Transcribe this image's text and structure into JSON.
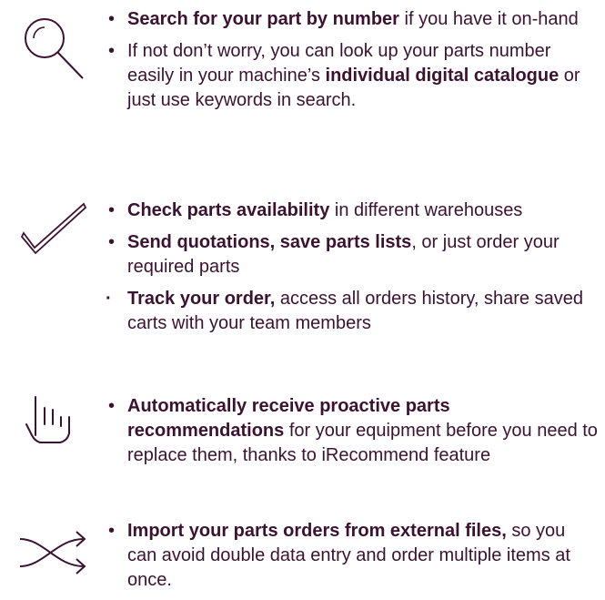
{
  "colors": {
    "text": "#3b1230",
    "icon": "#3b1230",
    "background": "#ffffff"
  },
  "sections": [
    {
      "icon": "magnifier-icon",
      "items": [
        {
          "parts": [
            {
              "text": "Search for your part by number",
              "bold": true
            },
            {
              "text": " if you have it on-hand",
              "bold": false
            }
          ]
        },
        {
          "parts": [
            {
              "text": "If not don’t worry, you can look up your parts number easily in your machine’s ",
              "bold": false
            },
            {
              "text": "individual digital catalogue",
              "bold": true
            },
            {
              "text": " or just use keywords in search.",
              "bold": false
            }
          ]
        }
      ]
    },
    {
      "icon": "checkmark-icon",
      "items": [
        {
          "parts": [
            {
              "text": "Check parts availability",
              "bold": true
            },
            {
              "text": " in different warehouses",
              "bold": false
            }
          ]
        },
        {
          "parts": [
            {
              "text": "Send quotations, save parts lists",
              "bold": true
            },
            {
              "text": ", or just order your required parts",
              "bold": false
            }
          ]
        },
        {
          "parts": [
            {
              "text": "Track your order,",
              "bold": true
            },
            {
              "text": " access all orders history, share saved carts with your team members",
              "bold": false
            }
          ]
        }
      ]
    },
    {
      "icon": "hand-pointer-icon",
      "items": [
        {
          "parts": [
            {
              "text": "Automatically receive proactive parts recommendations",
              "bold": true
            },
            {
              "text": " for your equipment before you need to replace them, thanks to iRecommend feature",
              "bold": false
            }
          ]
        }
      ]
    },
    {
      "icon": "shuffle-arrows-icon",
      "items": [
        {
          "parts": [
            {
              "text": "Import your parts orders from external files,",
              "bold": true
            },
            {
              "text": " so you can avoid double data entry and order multiple items at once.",
              "bold": false
            }
          ]
        }
      ]
    }
  ]
}
